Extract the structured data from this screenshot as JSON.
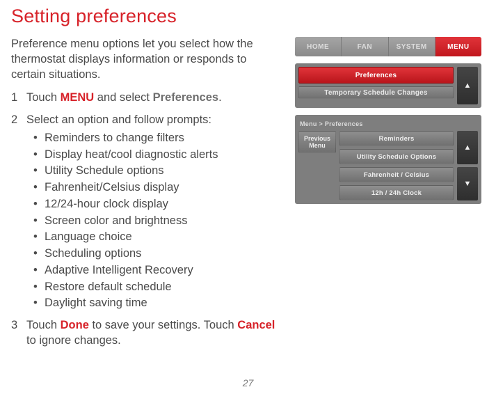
{
  "title": "Setting preferences",
  "intro": "Preference menu options let you select how the thermostat displays information or responds to certain situations.",
  "steps": {
    "s1_a": "Touch ",
    "s1_menu": "MENU",
    "s1_b": " and select ",
    "s1_pref": "Preferences",
    "s1_c": ".",
    "s2_lead": "Select an option and follow prompts:",
    "s3_a": "Touch ",
    "s3_done": "Done",
    "s3_b": " to save your settings. Touch ",
    "s3_cancel": "Cancel",
    "s3_c": " to ignore changes."
  },
  "options": [
    "Reminders to change filters",
    "Display heat/cool diagnostic alerts",
    "Utility Schedule options",
    "Fahrenheit/Celsius display",
    "12/24-hour clock display",
    "Screen color and brightness",
    "Language choice",
    "Scheduling options",
    "Adaptive Intelligent Recovery",
    "Restore default schedule",
    "Daylight saving time"
  ],
  "nav": {
    "home": "HOME",
    "fan": "FAN",
    "system": "SYSTEM",
    "menu": "MENU"
  },
  "panel1": {
    "item1": "Preferences",
    "item2": "Temporary Schedule Changes"
  },
  "panel2": {
    "breadcrumb": "Menu > Preferences",
    "prev_line1": "Previous",
    "prev_line2": "Menu",
    "opt1": "Reminders",
    "opt2": "Utility Schedule Options",
    "opt3": "Fahrenheit / Celsius",
    "opt4": "12h / 24h Clock"
  },
  "arrows": {
    "up": "▲",
    "down": "▼"
  },
  "page": "27"
}
